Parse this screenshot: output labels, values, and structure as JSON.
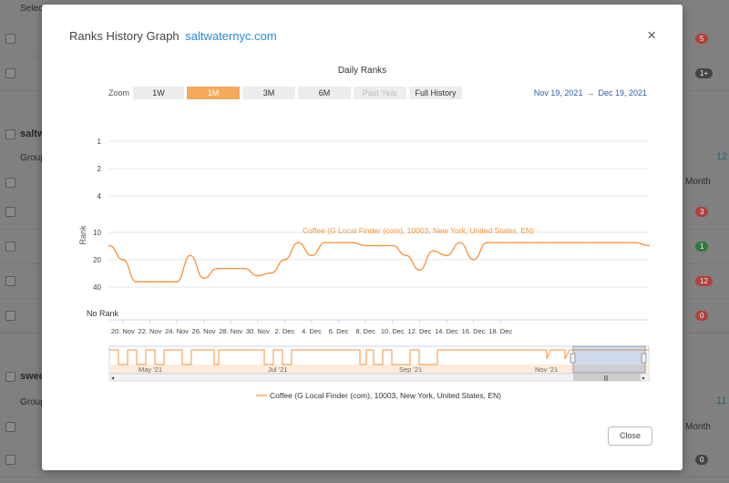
{
  "background": {
    "top_label": "Selec",
    "rows": [
      {
        "badge": "5",
        "badge_color": "#d9534f"
      },
      {
        "badge": "1+",
        "badge_color": "#444444"
      }
    ],
    "group1": {
      "name": "saltw",
      "group_label": "Group",
      "count": "12",
      "month": "Month"
    },
    "group1_rows": [
      {
        "badge": "3",
        "badge_color": "#d9534f"
      },
      {
        "badge": "1",
        "badge_color": "#3c9a4e"
      },
      {
        "badge": "12",
        "badge_color": "#d9534f"
      },
      {
        "badge": "0",
        "badge_color": "#d9534f"
      }
    ],
    "group2": {
      "name": "swee",
      "group_label": "Group",
      "count": "11",
      "month": "Month"
    },
    "group2_rows": [
      {
        "badge": "0",
        "badge_color": "#444444"
      }
    ]
  },
  "modal": {
    "title": "Ranks History Graph",
    "site": "saltwaternyc.com",
    "close_icon": "×",
    "chart_title": "Daily Ranks",
    "zoom_label": "Zoom",
    "zoom_buttons": [
      "1W",
      "1M",
      "3M",
      "6M",
      "Past Year",
      "Full History"
    ],
    "active_zoom": "1M",
    "range_start": "Nov 19, 2021",
    "range_arrow": "→",
    "range_end": "Dec 19, 2021",
    "close_button": "Close"
  },
  "chart_data": {
    "type": "line",
    "ylabel": "Rank",
    "y_ticks": [
      "1",
      "2",
      "4",
      "10",
      "20",
      "40"
    ],
    "no_rank_label": "No Rank",
    "x_ticks": [
      "20. Nov",
      "22. Nov",
      "24. Nov",
      "26. Nov",
      "28. Nov",
      "30. Nov",
      "2. Dec",
      "4. Dec",
      "6. Dec",
      "8. Dec",
      "10. Dec",
      "12. Dec",
      "14. Dec",
      "16. Dec",
      "18. Dec"
    ],
    "series": [
      {
        "name": "Coffee (G Local Finder (com), 10003, New York, United States, EN)",
        "color": "#f7923a",
        "x_start": "Nov 19, 2021",
        "values": [
          14,
          20,
          35,
          35,
          35,
          35,
          18,
          32,
          25,
          25,
          25,
          30,
          28,
          20,
          13,
          18,
          13,
          13,
          13,
          14,
          14,
          14,
          18,
          26,
          16,
          18,
          13,
          20,
          13,
          13,
          13,
          13,
          13,
          13,
          13,
          13,
          13,
          13,
          13,
          13,
          14
        ]
      }
    ],
    "navigator_labels": [
      "May '21",
      "Jul '21",
      "Sep '21",
      "Nov '21"
    ],
    "navigator_scroll_label": "|||"
  }
}
